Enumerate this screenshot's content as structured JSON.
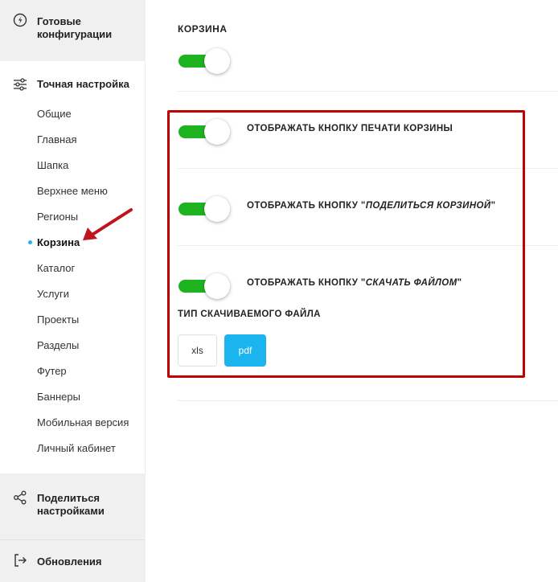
{
  "sidebar": {
    "configs_label": "Готовые конфигурации",
    "tuning_label": "Точная настройка",
    "items": [
      {
        "label": "Общие"
      },
      {
        "label": "Главная"
      },
      {
        "label": "Шапка"
      },
      {
        "label": "Верхнее меню"
      },
      {
        "label": "Регионы"
      },
      {
        "label": "Корзина",
        "active": true
      },
      {
        "label": "Каталог"
      },
      {
        "label": "Услуги"
      },
      {
        "label": "Проекты"
      },
      {
        "label": "Разделы"
      },
      {
        "label": "Футер"
      },
      {
        "label": "Баннеры"
      },
      {
        "label": "Мобильная версия"
      },
      {
        "label": "Личный кабинет"
      }
    ],
    "share_label": "Поделиться настройками",
    "updates_label": "Обновления"
  },
  "main": {
    "title": "КОРЗИНА",
    "main_toggle_on": true,
    "options": [
      {
        "pre": "ОТОБРАЖАТЬ КНОПКУ ПЕЧАТИ КОРЗИНЫ",
        "em": "",
        "post": "",
        "on": true
      },
      {
        "pre": "ОТОБРАЖАТЬ КНОПКУ \"",
        "em": "ПОДЕЛИТЬСЯ КОРЗИНОЙ",
        "post": "\"",
        "on": true
      },
      {
        "pre": "ОТОБРАЖАТЬ КНОПКУ \"",
        "em": "СКАЧАТЬ ФАЙЛОМ",
        "post": "\"",
        "on": true
      }
    ],
    "file_type_title": "ТИП СКАЧИВАЕМОГО ФАЙЛА",
    "file_types": [
      "xls",
      "pdf"
    ],
    "selected_file_type": "pdf"
  },
  "colors": {
    "toggle_on": "#1fb41f",
    "accent": "#1cb4ef",
    "highlight_border": "#c00000",
    "annotation_arrow": "#c0141c"
  }
}
